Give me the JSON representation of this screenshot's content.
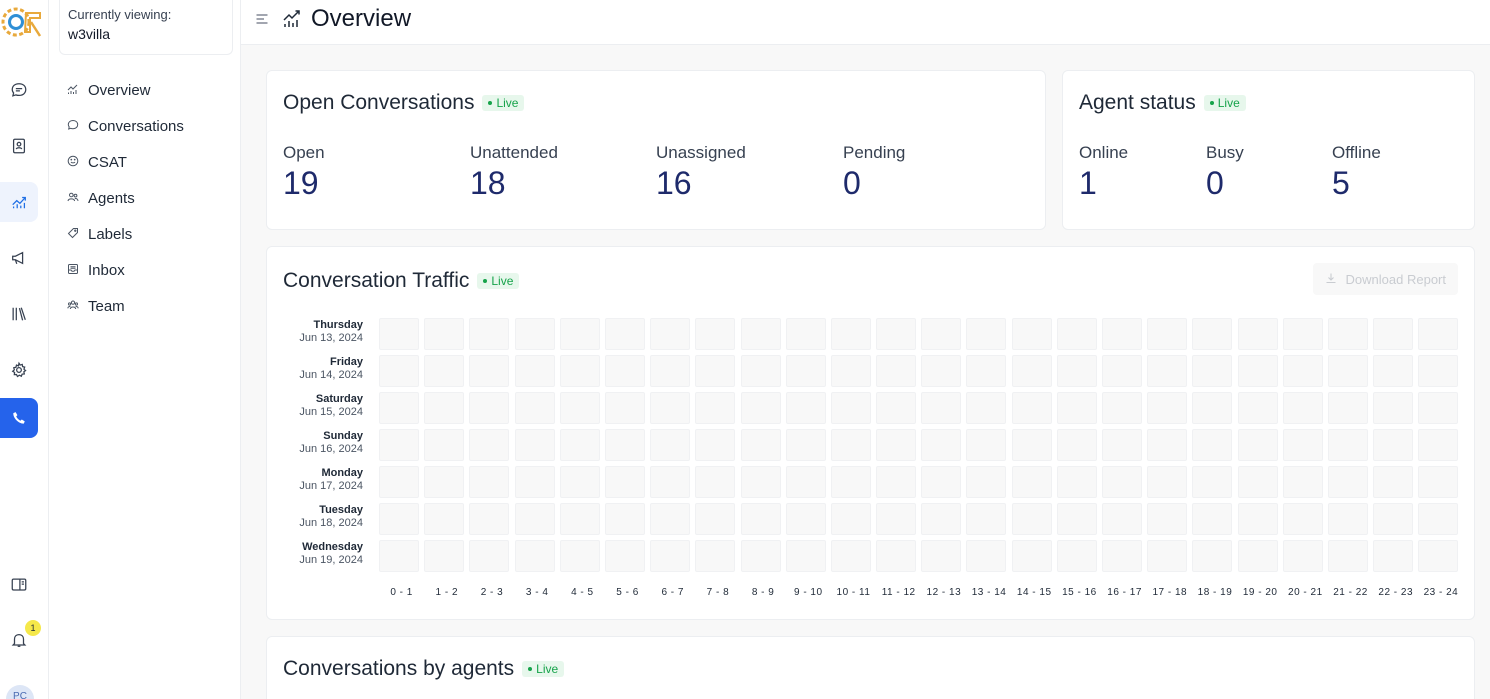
{
  "rail": {
    "items": [
      {
        "name": "conversations-icon"
      },
      {
        "name": "contacts-icon"
      },
      {
        "name": "reports-icon",
        "active": true
      },
      {
        "name": "campaigns-icon"
      },
      {
        "name": "library-icon"
      },
      {
        "name": "settings-icon"
      },
      {
        "name": "call-icon"
      }
    ],
    "notifications_count": "1",
    "avatar_initials": "PC"
  },
  "sidebar": {
    "viewing_caption": "Currently viewing:",
    "account_name": "w3villa",
    "items": [
      {
        "label": "Overview"
      },
      {
        "label": "Conversations"
      },
      {
        "label": "CSAT"
      },
      {
        "label": "Agents"
      },
      {
        "label": "Labels"
      },
      {
        "label": "Inbox"
      },
      {
        "label": "Team"
      }
    ]
  },
  "header": {
    "title": "Overview"
  },
  "open_conversations": {
    "title": "Open Conversations",
    "live": "Live",
    "metrics": [
      {
        "label": "Open",
        "value": "19"
      },
      {
        "label": "Unattended",
        "value": "18"
      },
      {
        "label": "Unassigned",
        "value": "16"
      },
      {
        "label": "Pending",
        "value": "0"
      }
    ]
  },
  "agent_status": {
    "title": "Agent status",
    "live": "Live",
    "metrics": [
      {
        "label": "Online",
        "value": "1"
      },
      {
        "label": "Busy",
        "value": "0"
      },
      {
        "label": "Offline",
        "value": "5"
      }
    ]
  },
  "traffic": {
    "title": "Conversation Traffic",
    "live": "Live",
    "download_label": "Download Report",
    "days": [
      {
        "name": "Thursday",
        "date": "Jun 13, 2024"
      },
      {
        "name": "Friday",
        "date": "Jun 14, 2024"
      },
      {
        "name": "Saturday",
        "date": "Jun 15, 2024"
      },
      {
        "name": "Sunday",
        "date": "Jun 16, 2024"
      },
      {
        "name": "Monday",
        "date": "Jun 17, 2024"
      },
      {
        "name": "Tuesday",
        "date": "Jun 18, 2024"
      },
      {
        "name": "Wednesday",
        "date": "Jun 19, 2024"
      }
    ],
    "hours": [
      "0 - 1",
      "1 - 2",
      "2 - 3",
      "3 - 4",
      "4 - 5",
      "5 - 6",
      "6 - 7",
      "7 - 8",
      "8 - 9",
      "9 - 10",
      "10 - 11",
      "11 - 12",
      "12 - 13",
      "13 - 14",
      "14 - 15",
      "15 - 16",
      "16 - 17",
      "17 - 18",
      "18 - 19",
      "19 - 20",
      "20 - 21",
      "21 - 22",
      "22 - 23",
      "23 - 24"
    ]
  },
  "agents_section": {
    "title": "Conversations by agents",
    "live": "Live"
  }
}
